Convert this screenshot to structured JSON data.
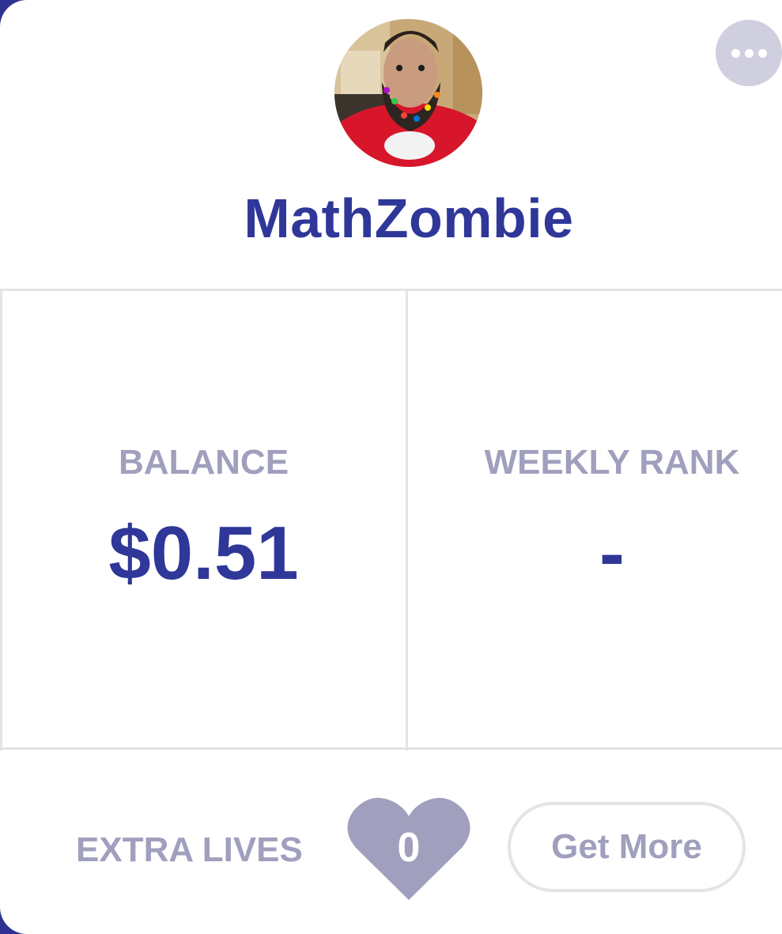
{
  "profile": {
    "username": "MathZombie",
    "avatar_icon": "user-avatar-photo",
    "more_icon": "more-horizontal-icon"
  },
  "stats": {
    "balance_label": "BALANCE",
    "balance_value": "$0.51",
    "rank_label": "WEEKLY RANK",
    "rank_value": "-"
  },
  "lives": {
    "label": "EXTRA LIVES",
    "count": "0",
    "heart_icon": "heart-icon",
    "get_more_label": "Get More"
  },
  "colors": {
    "primary": "#2f3799",
    "muted": "#a09fbd",
    "heart": "#a09fbd",
    "divider": "#e4e4e4",
    "more_button": "#cfcfe0"
  }
}
